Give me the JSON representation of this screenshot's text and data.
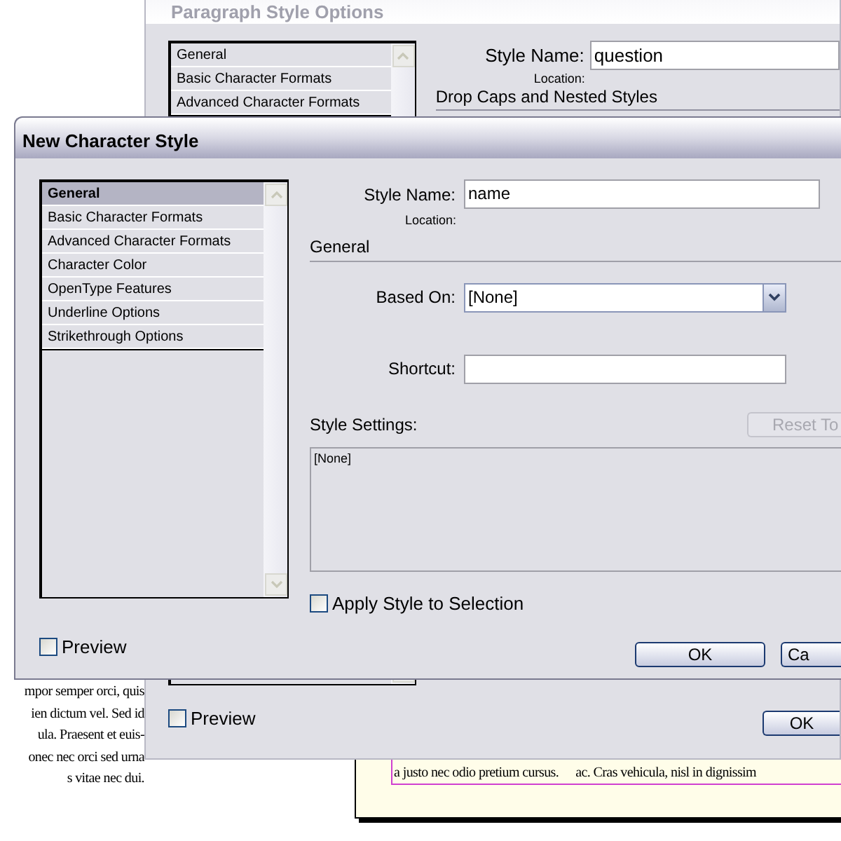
{
  "background_document": {
    "column_lines": [
      "mpor semper orci, quis",
      "ien dictum vel. Sed id",
      "ula. Praesent et euis-",
      "onec nec orci sed urna",
      "s vitae nec dui."
    ],
    "page_lines": [
      "a justo nec odio pretium cursus.",
      "ac. Cras vehicula, nisl in dignissim"
    ]
  },
  "back_dialog": {
    "title": "Paragraph Style Options",
    "categories": [
      {
        "label": "General",
        "selected": false
      },
      {
        "label": "Basic Character Formats",
        "selected": false
      },
      {
        "label": "Advanced Character Formats",
        "selected": false
      }
    ],
    "style_name": {
      "label": "Style Name:",
      "value": "question"
    },
    "location_label": "Location:",
    "section_title": "Drop Caps and Nested Styles",
    "preview": {
      "label": "Preview",
      "checked": false
    },
    "buttons": [
      "OK"
    ]
  },
  "dialog": {
    "title": "New Character Style",
    "categories": [
      {
        "label": "General",
        "selected": true
      },
      {
        "label": "Basic Character Formats",
        "selected": false
      },
      {
        "label": "Advanced Character Formats",
        "selected": false
      },
      {
        "label": "Character Color",
        "selected": false
      },
      {
        "label": "OpenType Features",
        "selected": false
      },
      {
        "label": "Underline Options",
        "selected": false
      },
      {
        "label": "Strikethrough Options",
        "selected": false
      }
    ],
    "style_name": {
      "label": "Style Name:",
      "value": "name"
    },
    "location_label": "Location:",
    "section_title": "General",
    "based_on": {
      "label": "Based On:",
      "value": "[None]"
    },
    "shortcut": {
      "label": "Shortcut:"
    },
    "style_settings": {
      "label": "Style Settings:",
      "text": "[None]"
    },
    "reset_button": {
      "label": "Reset To",
      "disabled": true
    },
    "apply_to_selection": {
      "label": "Apply Style to Selection",
      "checked": false
    },
    "preview": {
      "label": "Preview",
      "checked": false
    },
    "buttons": [
      "OK",
      "Ca"
    ]
  }
}
